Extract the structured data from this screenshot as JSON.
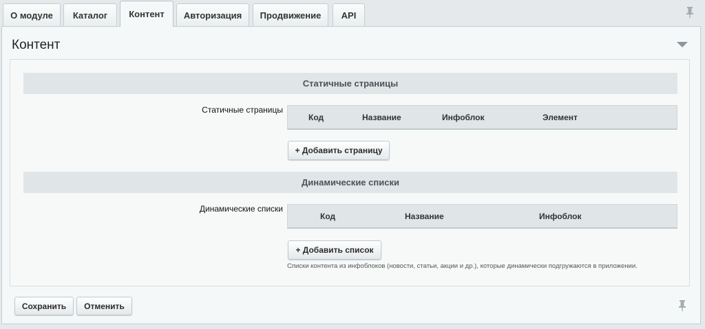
{
  "tabs": [
    {
      "label": "О модуле",
      "active": false
    },
    {
      "label": "Каталог",
      "active": false
    },
    {
      "label": "Контент",
      "active": true
    },
    {
      "label": "Авторизация",
      "active": false
    },
    {
      "label": "Продвижение",
      "active": false
    },
    {
      "label": "API",
      "active": false
    }
  ],
  "panel": {
    "title": "Контент"
  },
  "static_pages": {
    "section_title": "Статичные страницы",
    "field_label": "Статичные страницы",
    "columns": [
      "Код",
      "Название",
      "Инфоблок",
      "Элемент"
    ],
    "add_button": "+ Добавить страницу"
  },
  "dynamic_lists": {
    "section_title": "Динамические списки",
    "field_label": "Динамические списки",
    "columns": [
      "Код",
      "Название",
      "Инфоблок"
    ],
    "add_button": "+ Добавить список",
    "hint": "Списки контента из инфоблоков (новости, статьи, акции и др.), которые динамически подгружаются в приложении."
  },
  "footer": {
    "save_label": "Сохранить",
    "cancel_label": "Отменить"
  },
  "icons": {
    "pin": "pin-icon",
    "collapse": "chevron-down-icon"
  },
  "colors": {
    "page_bg": "#e5e9eb",
    "panel_bg": "#f5f8f9",
    "section_bg": "#e0e5e7",
    "border": "#c5cdd1"
  }
}
